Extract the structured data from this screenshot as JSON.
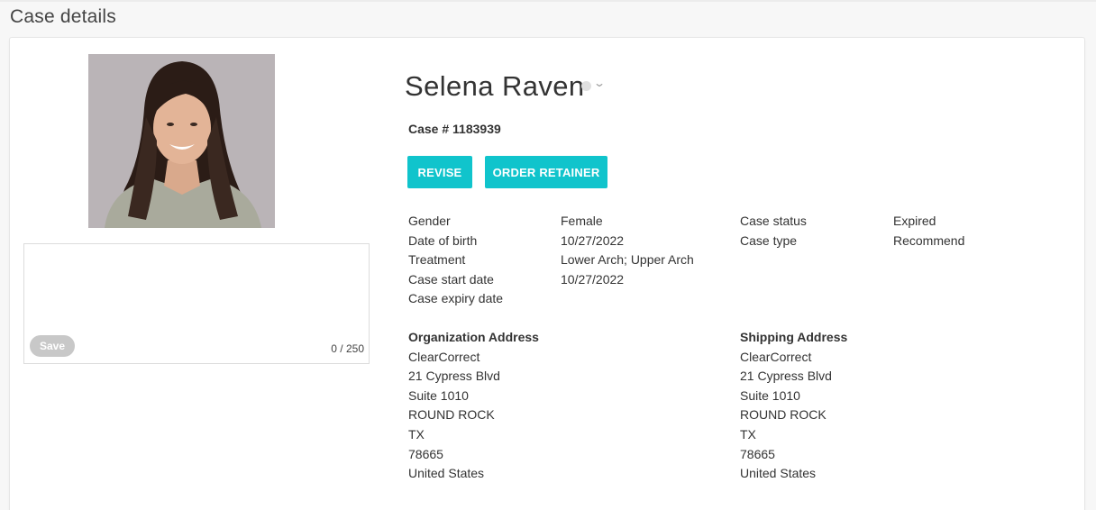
{
  "page": {
    "title": "Case details"
  },
  "patient": {
    "name": "Selena Raven",
    "case_number": "Case # 1183939"
  },
  "actions": {
    "revise_label": "REVISE",
    "order_retainer_label": "ORDER RETAINER"
  },
  "notes": {
    "value": "",
    "save_label": "Save",
    "char_count": "0 / 250"
  },
  "details_left": [
    {
      "label": "Gender",
      "value": "Female"
    },
    {
      "label": "Date of birth",
      "value": "10/27/2022"
    },
    {
      "label": "Treatment",
      "value": "Lower Arch; Upper Arch"
    },
    {
      "label": "Case start date",
      "value": "10/27/2022"
    },
    {
      "label": "Case expiry date",
      "value": ""
    }
  ],
  "details_right": [
    {
      "label": "Case status",
      "value": "Expired"
    },
    {
      "label": "Case type",
      "value": "Recommend"
    }
  ],
  "organization_address": {
    "title": "Organization Address",
    "lines": [
      "ClearCorrect",
      "21 Cypress Blvd",
      "Suite 1010",
      "ROUND ROCK",
      "TX",
      "78665",
      "United States"
    ]
  },
  "shipping_address": {
    "title": "Shipping Address",
    "lines": [
      "ClearCorrect",
      "21 Cypress Blvd",
      "Suite 1010",
      "ROUND ROCK",
      "TX",
      "78665",
      "United States"
    ]
  },
  "colors": {
    "accent": "#10c4cc",
    "save_disabled": "#c8c8c8"
  },
  "icons": {
    "status": "status-dot-icon",
    "dropdown": "chevron-down-icon"
  }
}
